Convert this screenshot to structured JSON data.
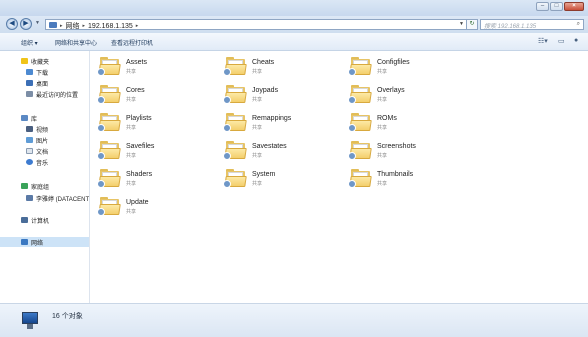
{
  "window": {
    "buttons": [
      "minimize",
      "maximize",
      "close"
    ]
  },
  "address": {
    "crumbs": [
      "网络",
      "192.168.1.135"
    ],
    "search_placeholder": "搜索 192.168.1.135"
  },
  "toolbar": {
    "organize": "组织 ▾",
    "network_sharing": "网络和共享中心",
    "view_printers": "查看远程打印机"
  },
  "sidebar": {
    "favorites": "收藏夹",
    "downloads": "下载",
    "desktop": "桌面",
    "recent": "最近访问的位置",
    "libraries": "库",
    "videos": "视频",
    "pictures": "图片",
    "documents": "文档",
    "music": "音乐",
    "homegroup": "家庭组",
    "homegroup_user": "李雅婷 (DATACENT",
    "computer": "计算机",
    "network": "网络"
  },
  "items": [
    {
      "name": "Assets",
      "sub": "共享"
    },
    {
      "name": "Cheats",
      "sub": "共享"
    },
    {
      "name": "Configfiles",
      "sub": "共享"
    },
    {
      "name": "Cores",
      "sub": "共享"
    },
    {
      "name": "Joypads",
      "sub": "共享"
    },
    {
      "name": "Overlays",
      "sub": "共享"
    },
    {
      "name": "Playlists",
      "sub": "共享"
    },
    {
      "name": "Remappings",
      "sub": "共享"
    },
    {
      "name": "ROMs",
      "sub": "共享"
    },
    {
      "name": "Savefiles",
      "sub": "共享"
    },
    {
      "name": "Savestates",
      "sub": "共享"
    },
    {
      "name": "Screenshots",
      "sub": "共享"
    },
    {
      "name": "Shaders",
      "sub": "共享"
    },
    {
      "name": "System",
      "sub": "共享"
    },
    {
      "name": "Thumbnails",
      "sub": "共享"
    },
    {
      "name": "Update",
      "sub": "共享"
    }
  ],
  "status": {
    "count": "16 个对象"
  },
  "colors": {
    "folder": "#f4cf6c",
    "selection": "#cde3f7",
    "accent": "#1e395b"
  }
}
